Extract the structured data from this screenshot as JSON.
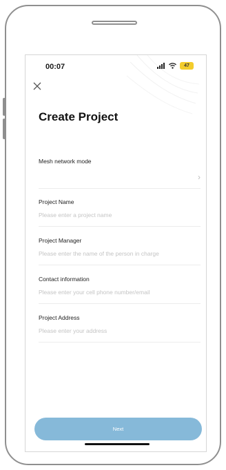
{
  "status_bar": {
    "time": "00:07",
    "battery": "47"
  },
  "page": {
    "title": "Create Project"
  },
  "form": {
    "mesh_mode": {
      "label": "Mesh network mode",
      "value": ""
    },
    "project_name": {
      "label": "Project Name",
      "placeholder": "Please enter a project name"
    },
    "project_manager": {
      "label": "Project Manager",
      "placeholder": "Please enter the name of the person in charge"
    },
    "contact_info": {
      "label": "Contact information",
      "placeholder": "Please enter your cell phone number/email"
    },
    "project_address": {
      "label": "Project Address",
      "placeholder": "Please enter your address"
    }
  },
  "actions": {
    "next_label": "Next"
  },
  "colors": {
    "accent": "#86b9d9",
    "battery": "#f3cc2c",
    "frame": "#8f8f8f"
  }
}
